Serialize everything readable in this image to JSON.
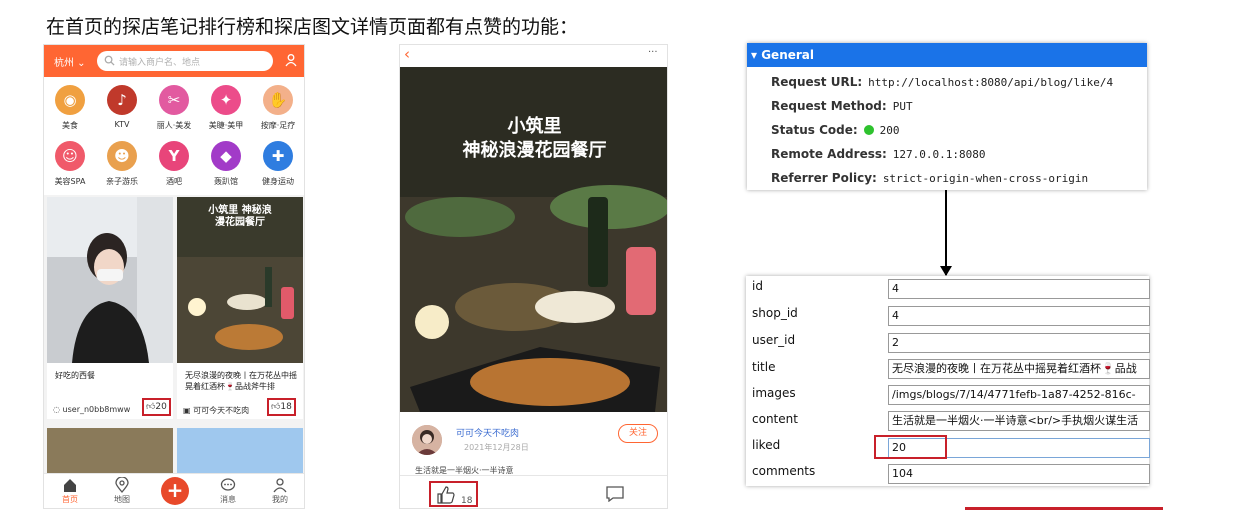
{
  "heading": "在首页的探店笔记排行榜和探店图文详情页面都有点赞的功能：",
  "colors": {
    "brand": "#ff6633",
    "highlight": "#c8202a",
    "devtools_header": "#1a73e8",
    "status_ok": "#2ec22e"
  },
  "home": {
    "city": "杭州",
    "search_placeholder": "请输入商户名、地点",
    "categories": [
      {
        "label": "美食",
        "icon": "food-icon",
        "color": "#f0a040",
        "glyph": "◉"
      },
      {
        "label": "KTV",
        "icon": "microphone-icon",
        "color": "#c0392b",
        "glyph": "♪"
      },
      {
        "label": "丽人·美发",
        "icon": "hair-icon",
        "color": "#e25aa0",
        "glyph": "✂"
      },
      {
        "label": "美睫·美甲",
        "icon": "nail-icon",
        "color": "#ec4c8a",
        "glyph": "✦"
      },
      {
        "label": "按摩·足疗",
        "icon": "massage-icon",
        "color": "#f3b08a",
        "glyph": "✋"
      },
      {
        "label": "美容SPA",
        "icon": "spa-icon",
        "color": "#f05a6a",
        "glyph": "☺"
      },
      {
        "label": "亲子游乐",
        "icon": "kids-icon",
        "color": "#e9a04e",
        "glyph": "☻"
      },
      {
        "label": "酒吧",
        "icon": "cocktail-icon",
        "color": "#e8457a",
        "glyph": "Y"
      },
      {
        "label": "轰趴馆",
        "icon": "mask-icon",
        "color": "#a23bc8",
        "glyph": "◆"
      },
      {
        "label": "健身运动",
        "icon": "dumbbell-icon",
        "color": "#2f7de0",
        "glyph": "✚"
      }
    ],
    "cards": [
      {
        "title": "好吃的西餐",
        "user": "user_n0bb8mww",
        "likes": "20"
      },
      {
        "title": "无尽浪漫的夜晚丨在万花丛中摇晃着红酒杯🍷品战斧牛排",
        "image_caption": "小筑里 神秘浪漫花园餐厅",
        "user": "可可今天不吃肉",
        "likes": "18"
      }
    ],
    "nav": [
      {
        "label": "首页",
        "icon": "home-icon"
      },
      {
        "label": "地图",
        "icon": "map-pin-icon"
      },
      {
        "label": "+",
        "icon": "plus-icon"
      },
      {
        "label": "消息",
        "icon": "message-icon"
      },
      {
        "label": "我的",
        "icon": "user-icon"
      }
    ]
  },
  "detail": {
    "image_title_line1": "小筑里",
    "image_title_line2": "神秘浪漫花园餐厅",
    "author": "可可今天不吃肉",
    "date": "2021年12月28日",
    "follow": "关注",
    "snippet": "生活就是一半烟火·一半诗意",
    "likes": "18"
  },
  "general": {
    "header": "▾ General",
    "rows": [
      {
        "key": "Request URL:",
        "value": "http://localhost:8080/api/blog/like/4"
      },
      {
        "key": "Request Method:",
        "value": "PUT"
      },
      {
        "key": "Status Code:",
        "value": "200"
      },
      {
        "key": "Remote Address:",
        "value": "127.0.0.1:8080"
      },
      {
        "key": "Referrer Policy:",
        "value": "strict-origin-when-cross-origin"
      }
    ]
  },
  "record": [
    {
      "key": "id",
      "value": "4"
    },
    {
      "key": "shop_id",
      "value": "4"
    },
    {
      "key": "user_id",
      "value": "2"
    },
    {
      "key": "title",
      "value": "无尽浪漫的夜晚丨在万花丛中摇晃着红酒杯🍷品战"
    },
    {
      "key": "images",
      "value": "/imgs/blogs/7/14/4771fefb-1a87-4252-816c-"
    },
    {
      "key": "content",
      "value": "生活就是一半烟火·一半诗意<br/>手执烟火谋生活"
    },
    {
      "key": "liked",
      "value": "20"
    },
    {
      "key": "comments",
      "value": "104"
    }
  ]
}
